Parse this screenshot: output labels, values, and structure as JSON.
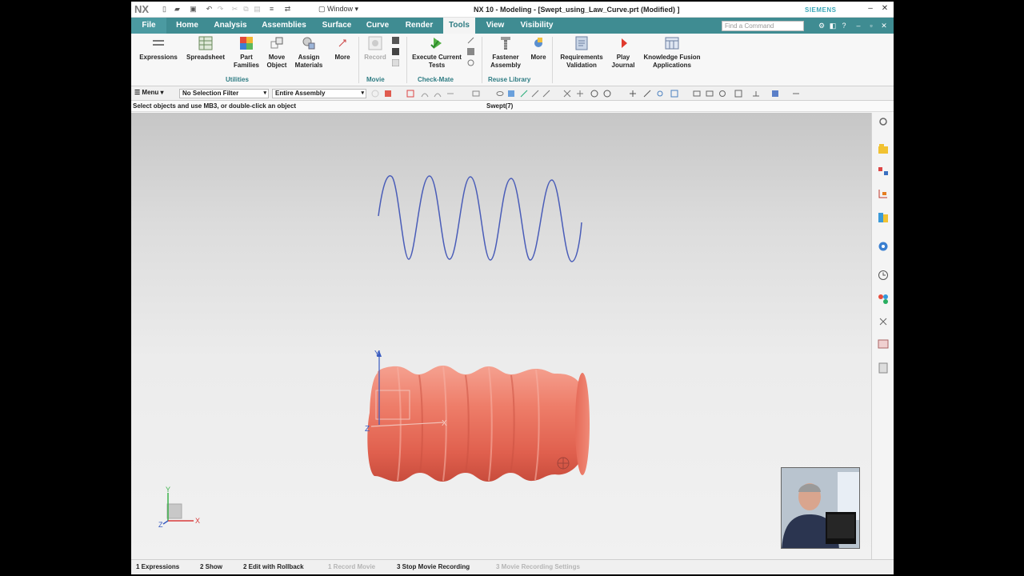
{
  "window": {
    "logo": "NX",
    "window_menu": "Window",
    "title": "NX 10 - Modeling - [Swept_using_Law_Curve.prt (Modified) ]",
    "brand": "SIEMENS"
  },
  "tabs": {
    "file": "File",
    "items": [
      "Home",
      "Analysis",
      "Assemblies",
      "Surface",
      "Curve",
      "Render",
      "Tools",
      "View",
      "Visibility"
    ],
    "active": "Tools",
    "search_placeholder": "Find a Command"
  },
  "ribbon": {
    "utilities": {
      "group_label": "Utilities",
      "buttons": [
        "Expressions",
        "Spreadsheet",
        "Part Families",
        "Move Object",
        "Assign Materials",
        "More"
      ]
    },
    "movie": {
      "group_label": "Movie",
      "buttons": [
        "Record"
      ]
    },
    "check_mate": {
      "group_label": "Check-Mate",
      "buttons": [
        "Execute Current Tests"
      ]
    },
    "reuse_library": {
      "group_label": "Reuse Library",
      "buttons": [
        "Fastener Assembly",
        "More"
      ]
    },
    "other_buttons": [
      "Requirements Validation",
      "Play Journal",
      "Knowledge Fusion Applications"
    ]
  },
  "selection_bar": {
    "menu_label": "Menu",
    "filter": "No Selection Filter",
    "scope": "Entire Assembly"
  },
  "cue_line": {
    "prompt": "Select objects and use MB3, or double-click an object",
    "status": "Swept(7)"
  },
  "triad": {
    "x": "X",
    "y": "Y",
    "z": "Z"
  },
  "bottom_bar": [
    {
      "label": "1 Expressions",
      "enabled": true
    },
    {
      "label": "2 Show",
      "enabled": true
    },
    {
      "label": "2 Edit with Rollback",
      "enabled": true
    },
    {
      "label": "1 Record Movie",
      "enabled": false
    },
    {
      "label": "3 Stop Movie Recording",
      "enabled": true
    },
    {
      "label": "3 Movie Recording Settings",
      "enabled": false
    }
  ],
  "colors": {
    "tab_bar": "#3f8c92",
    "accent": "#2e7c83",
    "body_solid": "#e8705f",
    "law_curve": "#4a5db8"
  }
}
